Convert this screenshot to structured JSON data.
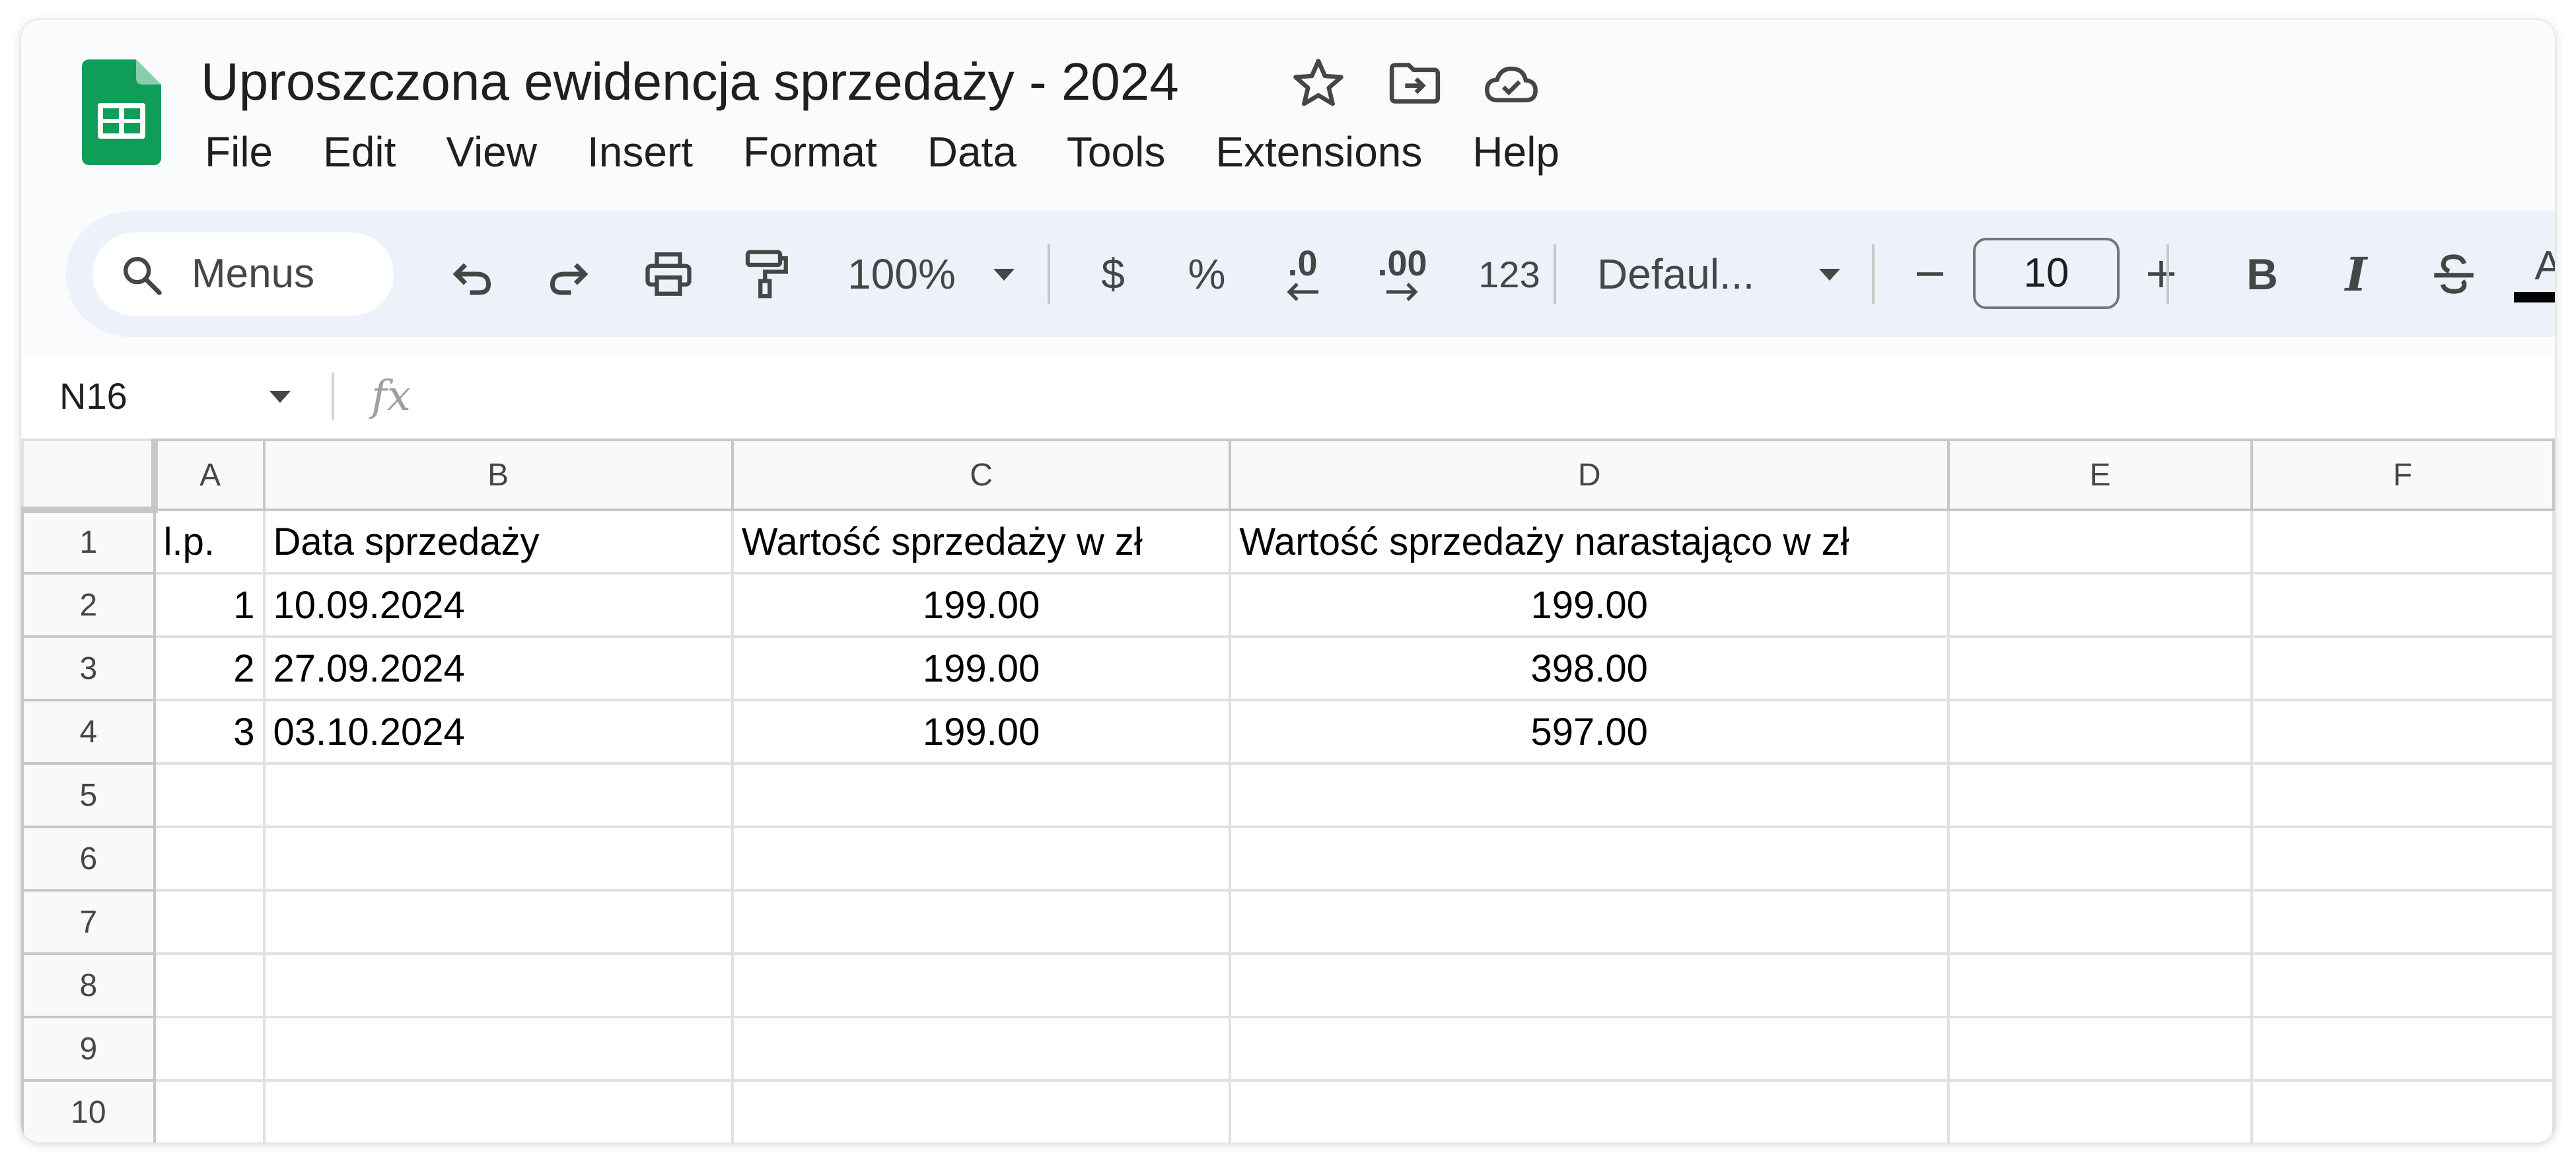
{
  "doc": {
    "title": "Uproszczona ewidencja sprzedaży - 2024"
  },
  "menu": [
    "File",
    "Edit",
    "View",
    "Insert",
    "Format",
    "Data",
    "Tools",
    "Extensions",
    "Help"
  ],
  "toolbar": {
    "search_label": "Menus",
    "zoom": "100%",
    "currency": "$",
    "percent": "%",
    "decrease_decimal": ".0",
    "increase_decimal": ".00",
    "number_format": "123",
    "font": "Defaul...",
    "font_size": "10",
    "bold": "B",
    "italic": "I",
    "text_color": "A"
  },
  "formula_bar": {
    "cell": "N16",
    "fx": "fx",
    "content": ""
  },
  "columns": [
    "A",
    "B",
    "C",
    "D",
    "E",
    "F"
  ],
  "rows": [
    [
      "l.p.",
      "Data sprzedaży",
      "Wartość sprzedaży w zł",
      "Wartość sprzedaży narastająco w zł",
      "",
      ""
    ],
    [
      "1",
      "10.09.2024",
      "199.00",
      "199.00",
      "",
      ""
    ],
    [
      "2",
      "27.09.2024",
      "199.00",
      "398.00",
      "",
      ""
    ],
    [
      "3",
      "03.10.2024",
      "199.00",
      "597.00",
      "",
      ""
    ],
    [
      "",
      "",
      "",
      "",
      "",
      ""
    ],
    [
      "",
      "",
      "",
      "",
      "",
      ""
    ],
    [
      "",
      "",
      "",
      "",
      "",
      ""
    ],
    [
      "",
      "",
      "",
      "",
      "",
      ""
    ],
    [
      "",
      "",
      "",
      "",
      "",
      ""
    ],
    [
      "",
      "",
      "",
      "",
      "",
      ""
    ]
  ],
  "row_numbers": [
    "1",
    "2",
    "3",
    "4",
    "5",
    "6",
    "7",
    "8",
    "9",
    "10"
  ],
  "colors": {
    "sheets_green": "#0f9d58",
    "toolbar_bg": "#edf2fa",
    "grid_line": "#e1e1e1"
  }
}
